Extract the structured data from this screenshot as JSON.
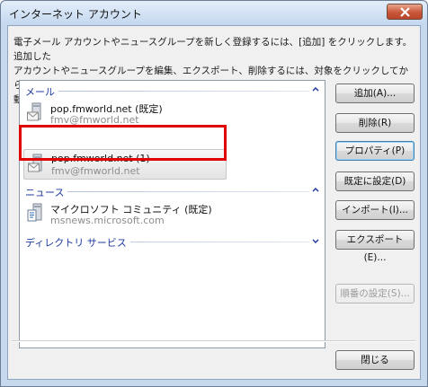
{
  "window": {
    "title": "インターネット アカウント"
  },
  "description": "電子メール アカウントやニュースグループを新しく登録するには、[追加] をクリックします。追加した\nアカウントやニュースグループを編集、エクスポート、削除するには、対象をクリックしてから、希望の\n動作をクリックします。",
  "list": {
    "mail_group": {
      "label": "メール",
      "accounts": [
        {
          "name": "pop.fmworld.net (既定)",
          "email": "fmv@fmworld.net"
        },
        {
          "name": "pop.fmworld.net (1)",
          "email": "fmv@fmworld.net",
          "selected": true
        }
      ]
    },
    "news_group": {
      "label": "ニュース",
      "accounts": [
        {
          "name": "マイクロソフト コミュニティ (既定)",
          "server": "msnews.microsoft.com"
        }
      ]
    },
    "directory_group": {
      "label": "ディレクトリ サービス"
    }
  },
  "buttons": {
    "add": "追加(A)...",
    "delete": "削除(R)",
    "properties": "プロパティ(P)",
    "set_default": "既定に設定(D)",
    "import": "インポート(I)...",
    "export": "エクスポート(E)...",
    "order": "順番の設定(S)...",
    "close": "閉じる"
  },
  "colors": {
    "group_label": "#1e3a9e",
    "highlight_box": "#e00000",
    "titlebar_close": "#c9573a"
  },
  "icons": {
    "mail_account": "mail-server-icon",
    "news_account": "news-server-icon",
    "collapse": "chevron-up-icon",
    "expand": "chevron-down-icon"
  }
}
